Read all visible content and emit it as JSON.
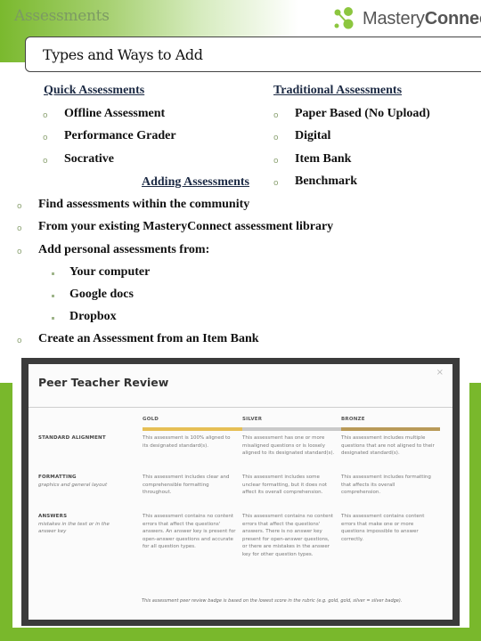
{
  "header": {
    "title": "Assessments",
    "logo": {
      "text_light": "Mastery",
      "text_bold": "Connect",
      "colors": {
        "accent": "#7ab92e",
        "text": "#555555"
      }
    }
  },
  "subtitle": "Types and Ways to Add",
  "quick": {
    "heading": "Quick Assessments",
    "items": [
      "Offline Assessment",
      "Performance Grader",
      "Socrative"
    ]
  },
  "traditional": {
    "heading": "Traditional Assessments",
    "items": [
      "Paper Based (No Upload)",
      "Digital",
      "Item Bank",
      "Benchmark"
    ]
  },
  "adding": {
    "heading": "Adding Assessments",
    "items": [
      "Find assessments within the community",
      "From your existing MasteryConnect assessment library",
      "Add personal assessments from:"
    ],
    "sub_items": [
      "Your computer",
      "Google docs",
      "Dropbox"
    ],
    "last_item": "Create an Assessment from an Item Bank"
  },
  "peer_review": {
    "title": "Peer Teacher Review",
    "close": "×",
    "levels": [
      {
        "label": "GOLD",
        "color": "#e6bf55"
      },
      {
        "label": "SILVER",
        "color": "#c9c9c9"
      },
      {
        "label": "BRONZE",
        "color": "#b99a59"
      }
    ],
    "criteria": [
      {
        "name": "STANDARD ALIGNMENT",
        "sub": "",
        "cells": [
          "This assessment is 100% aligned to its designated standard(s).",
          "This assessment has one or more misaligned questions or is loosely aligned to its designated standard(s).",
          "This assessment includes multiple questions that are not aligned to their designated standard(s)."
        ]
      },
      {
        "name": "FORMATTING",
        "sub": "graphics and general layout",
        "cells": [
          "This assessment includes clear and comprehensible formatting throughout.",
          "This assessment includes some unclear formatting, but it does not affect its overall comprehension.",
          "This assessment includes formatting that affects its overall comprehension."
        ]
      },
      {
        "name": "ANSWERS",
        "sub": "mistakes in the text or in the answer key",
        "cells": [
          "This assessment contains no content errors that affect the questions' answers. An answer key is present for open-answer questions and accurate for all question types.",
          "This assessment contains no content errors that affect the questions' answers. There is no answer key present for open-answer questions, or there are mistakes in the answer key for other question types.",
          "This assessment contains content errors that make one or more questions impossible to answer correctly."
        ]
      }
    ],
    "footnote": "This assessment peer review badge is based on the lowest score in the rubric (e.g. gold, gold, silver = silver badge)."
  }
}
